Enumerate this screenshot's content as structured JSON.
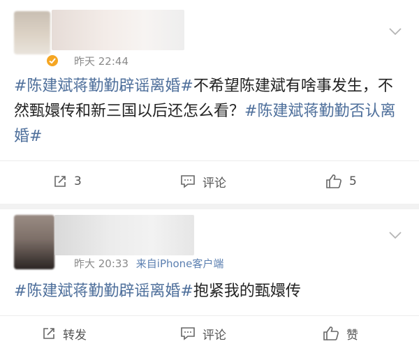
{
  "posts": [
    {
      "time": "昨天 22:44",
      "source": "",
      "content": [
        {
          "text": "#陈建斌蒋勤勤辟谣离婚#",
          "topic": true
        },
        {
          "text": "不希望陈建斌有啥事发生，不然甄嬛传和新三国以后还怎么看？",
          "topic": false
        },
        {
          "text": "#陈建斌蒋勤勤否认离婚#",
          "topic": true
        }
      ],
      "actions": {
        "repost": "3",
        "comment": "评论",
        "like": "5"
      }
    },
    {
      "time": "昨大 20:33",
      "source": "来自iPhone客户端",
      "content": [
        {
          "text": "#陈建斌蒋勤勤辟谣离婚#",
          "topic": true
        },
        {
          "text": "抱紧我的甄嬛传",
          "topic": false
        }
      ],
      "actions": {
        "repost": "转发",
        "comment": "评论",
        "like": "赞"
      }
    }
  ],
  "icons": {
    "more": "chevron-down-icon",
    "repost": "repost-icon",
    "comment": "comment-icon",
    "like": "thumbs-up-icon",
    "verified": "verified-badge-icon"
  },
  "colors": {
    "topic": "#4e6f9b",
    "verified": "#f5a623",
    "background": "#f2f2f2"
  }
}
